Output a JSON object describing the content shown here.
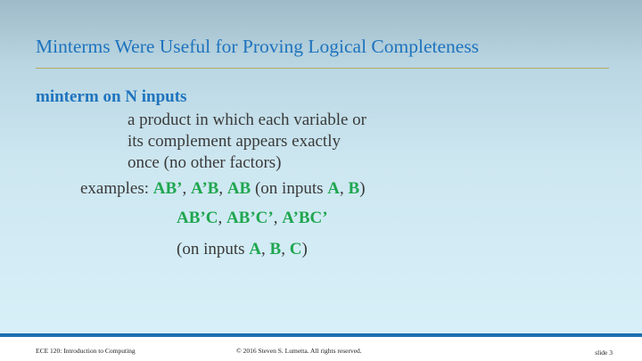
{
  "title": "Minterms Were Useful for Proving Logical Completeness",
  "term": "minterm on N inputs",
  "definition_lines": [
    "a product in which each variable or",
    "its complement appears exactly",
    "once (no other factors)"
  ],
  "examples": {
    "label": "examples: ",
    "line1": [
      "AB’",
      ", ",
      "A’B",
      ", ",
      "AB",
      " (on inputs ",
      "A",
      ", ",
      "B",
      ")"
    ],
    "line2": [
      "AB’C",
      ", ",
      "AB’C’",
      ", ",
      "A’BC’"
    ],
    "line3": [
      "(on inputs ",
      "A",
      ", ",
      "B",
      ", ",
      "C",
      ")"
    ]
  },
  "footer": {
    "course": "ECE 120: Introduction to Computing",
    "copyright": "© 2016 Steven S. Lumetta.  All rights reserved.",
    "slide": "slide 3"
  },
  "colors": {
    "title": "#1e73be",
    "term": "#1e73be",
    "highlight": "#1fa64f",
    "rule": "#b8aa5c",
    "footer_bar": "#1e6fb0"
  }
}
